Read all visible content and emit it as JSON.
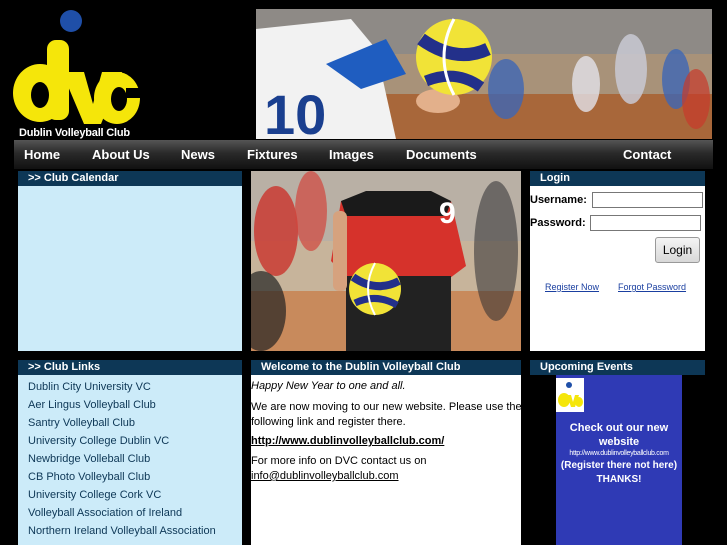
{
  "header": {
    "logo_text": "dvc",
    "club_name": "Dublin Volleyball Club"
  },
  "nav": {
    "items": [
      "Home",
      "About Us",
      "News",
      "Fixtures",
      "Images",
      "Documents",
      "Contact"
    ]
  },
  "calendar": {
    "title": ">> Club Calendar"
  },
  "login": {
    "title": "Login",
    "username_label": "Username:",
    "password_label": "Password:",
    "button": "Login",
    "register_link": "Register Now",
    "forgot_link": "Forgot Password"
  },
  "links": {
    "title": ">> Club Links",
    "items": [
      "Dublin City University VC",
      "Aer Lingus Volleyball Club",
      "Santry Volleyball Club",
      "University College Dublin VC",
      "Newbridge Volleball Club",
      "CB Photo Volleyball Club",
      "University College Cork VC",
      "Volleyball Association of Ireland",
      "Northern Ireland Volleyball Association"
    ]
  },
  "welcome": {
    "title": "Welcome to the Dublin Volleyball Club",
    "greeting": "Happy New Year to one and all.",
    "moving": "We are now moving to our new website. Please use the following link and register there.",
    "url": "http://www.dublinvolleyballclub.com/",
    "info": "For more info on DVC contact us on",
    "email": "info@dublinvolleyballclub.com"
  },
  "events": {
    "title": "Upcoming Events",
    "line1": "Check out our new website",
    "line2": "http://www.dublinvolleyballclub.com",
    "line3": "(Register there not here)",
    "line4": "THANKS!"
  },
  "banner": {
    "jersey_number": "10"
  },
  "photo": {
    "jersey_number": "9"
  },
  "colors": {
    "dark_blue": "#0d3756",
    "light_blue": "#ccebf9",
    "logo_yellow": "#f5e60a",
    "logo_blue": "#1f4fa8",
    "event_blue": "#2f3ab5"
  }
}
